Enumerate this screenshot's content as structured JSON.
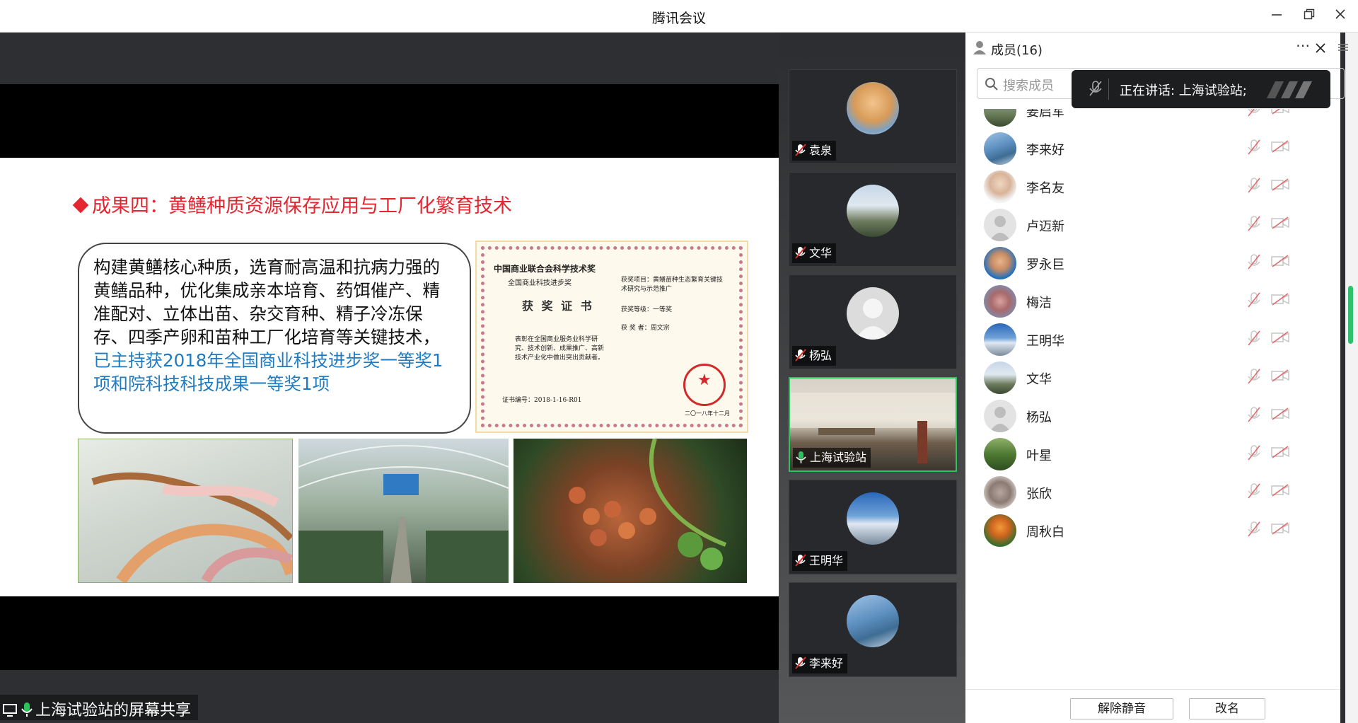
{
  "window": {
    "title": "腾讯会议"
  },
  "share": {
    "label": "上海试验站的屏幕共享",
    "slide": {
      "title": "成果四：黄鳝种质资源保存应用与工厂化繁育技术",
      "body_text": "构建黄鳝核心种质，选育耐高温和抗病力强的黄鳝品种，优化集成亲本培育、药饵催产、精准配对、立体出苗、杂交育种、精子冷冻保存、四季产卵和苗种工厂化培育等关键技术，",
      "highlight_text": "已主持获2018年全国商业科技进步奖一等奖1项和院科技科技成果一等奖1项",
      "certificate": {
        "org": "中国商业联合会科学技术奖",
        "award": "全国商业科技进步奖",
        "heading": "获 奖 证 书",
        "body": "表彰在全国商业服务业科学研究、技术创新、成果推广、高新技术产业化中做出突出贡献者。",
        "project": "获奖项目：黄鳝苗种生态繁育关键技术研究与示范推广",
        "level": "获奖等级：一等奖",
        "winner": "获 奖 者：周文宗",
        "cert_no": "证书编号：2018-1-16-R01",
        "date": "二〇一八年十二月"
      },
      "photos": [
        "eels-photo",
        "greenhouse-photo",
        "eggs-photo"
      ]
    }
  },
  "video_tiles": [
    {
      "name": "袁泉",
      "muted": true
    },
    {
      "name": "文华",
      "muted": true
    },
    {
      "name": "杨弘",
      "muted": true
    },
    {
      "name": "上海试验站",
      "muted": false,
      "active": true
    },
    {
      "name": "王明华",
      "muted": true
    },
    {
      "name": "李来好",
      "muted": true
    }
  ],
  "members": {
    "title": "成员(16)",
    "search_placeholder": "搜索成员",
    "speaking_toast": "正在讲话: 上海试验站;",
    "list": [
      {
        "name": "姜启军"
      },
      {
        "name": "李来好"
      },
      {
        "name": "李名友"
      },
      {
        "name": "卢迈新"
      },
      {
        "name": "罗永巨"
      },
      {
        "name": "梅洁"
      },
      {
        "name": "王明华"
      },
      {
        "name": "文华"
      },
      {
        "name": "杨弘"
      },
      {
        "name": "叶星"
      },
      {
        "name": "张欣"
      },
      {
        "name": "周秋白"
      }
    ],
    "unmute_button": "解除静音",
    "rename_button": "改名"
  },
  "colors": {
    "accent": "#29c45a",
    "slide_title": "#e3262f",
    "highlight": "#1f7bc1"
  }
}
